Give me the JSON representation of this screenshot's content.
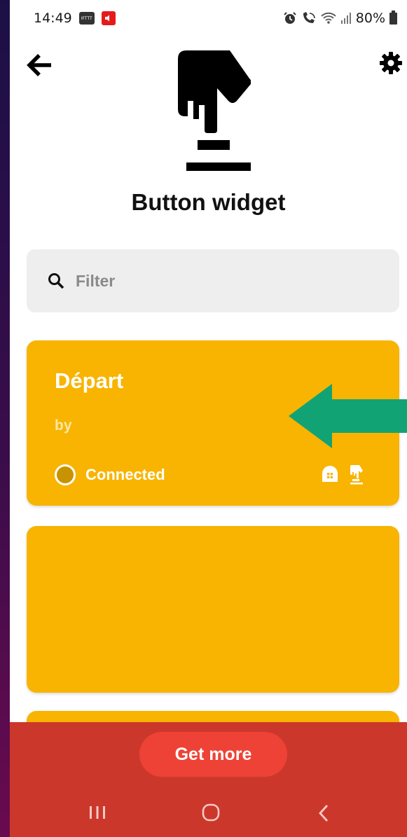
{
  "status_bar": {
    "time": "14:49",
    "battery": "80%",
    "icons": [
      "ifttt-notification-icon",
      "speaker-notification-icon",
      "alarm-icon",
      "wifi-calling-icon",
      "wifi-icon",
      "signal-icon",
      "battery-icon"
    ]
  },
  "header": {
    "title": "Button widget",
    "back_icon": "arrow-left-icon",
    "settings_icon": "gear-icon",
    "hero_icon": "pressing-finger-button-icon"
  },
  "search": {
    "placeholder": "Filter",
    "icon": "search-icon"
  },
  "cards": [
    {
      "title": "Départ",
      "by": "by",
      "status": "Connected",
      "service_icons": [
        "home-service-icon",
        "button-widget-icon"
      ]
    },
    {
      "title": "",
      "by": "",
      "status": ""
    },
    {
      "title": "",
      "by": "",
      "status": ""
    }
  ],
  "annotation": {
    "arrow_color": "#12a374",
    "points_to": "Départ card"
  },
  "footer": {
    "get_more_label": "Get more"
  },
  "colors": {
    "card": "#f8b400",
    "footer": "#cb382b",
    "get_more_button": "#ee4236",
    "search_bg": "#eeeeee"
  }
}
